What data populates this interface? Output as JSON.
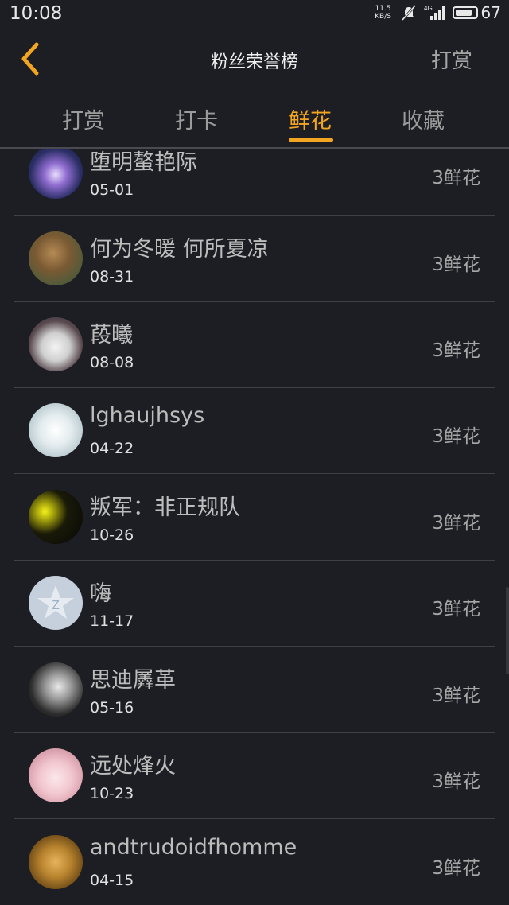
{
  "status": {
    "time": "10:08",
    "net_speed_value": "11.5",
    "net_speed_unit": "KB/S",
    "network": "4G",
    "battery": "67"
  },
  "header": {
    "title": "粉丝荣誉榜",
    "right_action": "打赏"
  },
  "tabs": [
    {
      "label": "打赏",
      "active": false
    },
    {
      "label": "打卡",
      "active": false
    },
    {
      "label": "鲜花",
      "active": true
    },
    {
      "label": "收藏",
      "active": false
    }
  ],
  "list": [
    {
      "name": "堕明螯艳际",
      "date": "05-01",
      "amount": "3鲜花"
    },
    {
      "name": "何为冬暖 何所夏凉",
      "date": "08-31",
      "amount": "3鲜花"
    },
    {
      "name": "葮曦",
      "date": "08-08",
      "amount": "3鲜花"
    },
    {
      "name": "lghaujhsys",
      "date": "04-22",
      "amount": "3鲜花"
    },
    {
      "name": "叛军：非正规队",
      "date": "10-26",
      "amount": "3鲜花"
    },
    {
      "name": "嗨",
      "date": "11-17",
      "amount": "3鲜花"
    },
    {
      "name": "思迪羼革",
      "date": "05-16",
      "amount": "3鲜花"
    },
    {
      "name": "远处烽火",
      "date": "10-23",
      "amount": "3鲜花"
    },
    {
      "name": "andtrudoidfhomme",
      "date": "04-15",
      "amount": "3鲜花"
    }
  ],
  "colors": {
    "background": "#1d1e23",
    "accent": "#f2a521"
  }
}
